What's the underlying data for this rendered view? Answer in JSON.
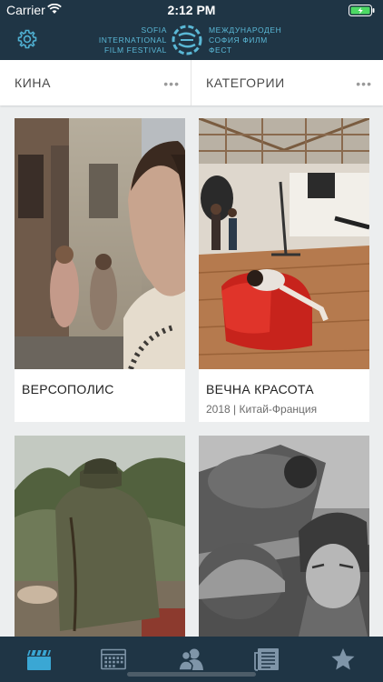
{
  "status_bar": {
    "carrier": "Carrier",
    "time": "2:12 PM"
  },
  "header": {
    "logo_left_lines": [
      "SOFIA",
      "INTERNATIONAL",
      "FILM FESTIVAL"
    ],
    "logo_right_lines": [
      "МЕЖДУНАРОДЕН",
      "СОФИЯ ФИЛМ",
      "ФЕСТ"
    ],
    "settings_icon": "gear-icon",
    "accent_color": "#5ab8d6",
    "bar_color": "#1f3545"
  },
  "tabs": [
    {
      "label": "КИНА",
      "more": "•••"
    },
    {
      "label": "КАТЕГОРИИ",
      "more": "•••"
    }
  ],
  "films": [
    {
      "title": "ВЕРСОПОЛИС",
      "meta": ""
    },
    {
      "title": "ВЕЧНА КРАСОТА",
      "meta": "2018 | Китай-Франция"
    },
    {
      "title": "",
      "meta": ""
    },
    {
      "title": "",
      "meta": ""
    }
  ],
  "bottom_tabs": [
    {
      "icon": "clapperboard-icon",
      "active": true
    },
    {
      "icon": "calendar-icon",
      "active": false
    },
    {
      "icon": "people-icon",
      "active": false
    },
    {
      "icon": "newspaper-icon",
      "active": false
    },
    {
      "icon": "star-icon",
      "active": false
    }
  ]
}
